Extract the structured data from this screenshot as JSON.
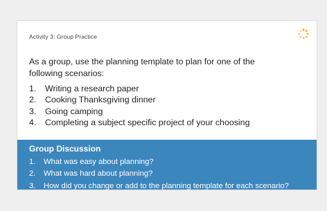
{
  "card": {
    "title": "Activity 3: Group Practice",
    "intro": "As a group, use the planning template to plan for one of the following scenarios:",
    "scenarios": [
      {
        "num": "1.",
        "text": "Writing a research paper"
      },
      {
        "num": "2.",
        "text": "Cooking Thanksgiving dinner"
      },
      {
        "num": "3.",
        "text": "Going camping"
      },
      {
        "num": "4.",
        "text": "Completing a  subject specific project of your choosing"
      }
    ],
    "spinner_icon": "loading-spinner-icon",
    "spinner_color": "#f5a623"
  },
  "discussion": {
    "title": "Group Discussion",
    "questions": [
      {
        "num": "1.",
        "text": "What was easy about planning?"
      },
      {
        "num": "2.",
        "text": "What was hard about planning?"
      },
      {
        "num": "3.",
        "text": "How did you change or add to the planning template for each scenario?"
      }
    ],
    "background_color": "#3b86bd"
  }
}
